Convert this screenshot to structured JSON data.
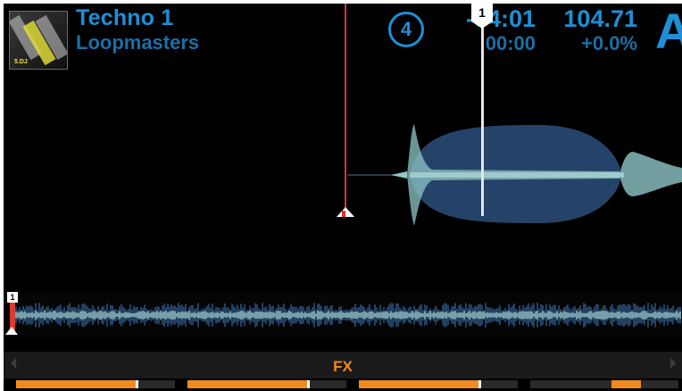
{
  "deck": {
    "title": "Techno 1",
    "artist": "Loopmasters",
    "beat_counter": "4",
    "time_remaining": "-04:01",
    "time_elapsed": "00:00",
    "bpm": "104.71",
    "tempo_offset": "+0.0%",
    "deck_letter": "A",
    "cover_tag": "5.DJ"
  },
  "waveform": {
    "cue_number": "1",
    "overview_cue_number": "1"
  },
  "fx": {
    "label": "FX",
    "knobs": [
      {
        "name": "fx-knob-1",
        "level": 0.75
      },
      {
        "name": "fx-knob-2",
        "level": 0.75
      },
      {
        "name": "fx-knob-3",
        "level": 0.75
      },
      {
        "name": "fx-knob-4",
        "level": 0.2
      }
    ]
  },
  "colors": {
    "accent": "#1e8fd6",
    "accent_dim": "#1b6fa7",
    "playhead": "#e03030",
    "fx": "#f28a1e",
    "wave": "#2b4f7a",
    "wave_light": "#9ecfd0"
  }
}
